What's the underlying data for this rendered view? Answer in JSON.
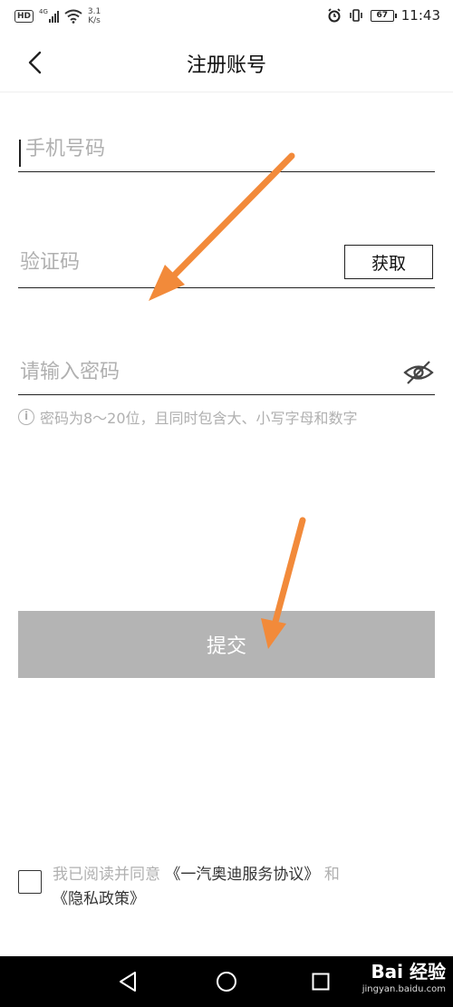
{
  "status_bar": {
    "left_badge": "HD",
    "network": "4G",
    "speed_value": "3.1",
    "speed_unit": "K/s",
    "battery": "67",
    "time": "11:43"
  },
  "header": {
    "title": "注册账号"
  },
  "form": {
    "phone_placeholder": "手机号码",
    "code_placeholder": "验证码",
    "get_code_label": "获取",
    "password_placeholder": "请输入密码",
    "password_hint": "密码为8～20位，且同时包含大、小写字母和数字",
    "submit_label": "提交"
  },
  "agreement": {
    "prefix": "我已阅读并同意",
    "service_link": "《一汽奥迪服务协议》",
    "and_text": "和",
    "privacy_link": "《隐私政策》"
  },
  "watermark": {
    "logo": "Bai 经验",
    "url": "jingyan.baidu.com"
  },
  "colors": {
    "annotation_arrow": "#f28a3a",
    "submit_disabled": "#b4b4b4",
    "placeholder": "#b0b0b0"
  }
}
